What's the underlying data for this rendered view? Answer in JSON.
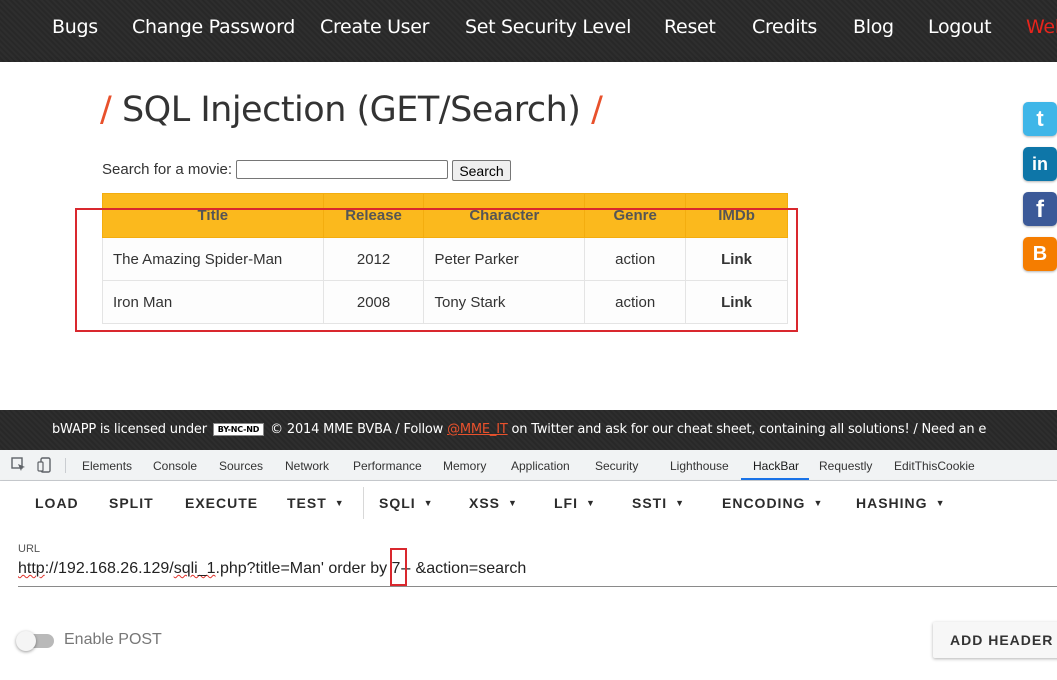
{
  "nav": {
    "items": [
      "Bugs",
      "Change Password",
      "Create User",
      "Set Security Level",
      "Reset",
      "Credits",
      "Blog",
      "Logout",
      "Wel"
    ]
  },
  "page": {
    "title": "SQL Injection (GET/Search)",
    "title_slash": "/"
  },
  "search": {
    "label": "Search for a movie:",
    "value": "",
    "button": "Search"
  },
  "table": {
    "headers": [
      "Title",
      "Release",
      "Character",
      "Genre",
      "IMDb"
    ],
    "rows": [
      [
        "The Amazing Spider-Man",
        "2012",
        "Peter Parker",
        "action",
        "Link"
      ],
      [
        "Iron Man",
        "2008",
        "Tony Stark",
        "action",
        "Link"
      ]
    ]
  },
  "social": [
    "t",
    "in",
    "f",
    "B"
  ],
  "footer": {
    "before": "bWAPP is licensed under",
    "badge": "BY-NC-ND",
    "middle": "© 2014 MME BVBA / Follow",
    "handle": "@MME_IT",
    "after": "on Twitter and ask for our cheat sheet, containing all solutions! / Need an e"
  },
  "devtools": {
    "tabs": [
      "Elements",
      "Console",
      "Sources",
      "Network",
      "Performance",
      "Memory",
      "Application",
      "Security",
      "Lighthouse",
      "HackBar",
      "Requestly",
      "EditThisCookie"
    ],
    "active_tab": "HackBar"
  },
  "hackbar": {
    "buttons": [
      "LOAD",
      "SPLIT",
      "EXECUTE",
      "TEST",
      "SQLI",
      "XSS",
      "LFI",
      "SSTI",
      "ENCODING",
      "HASHING"
    ],
    "url_label": "URL",
    "url": {
      "scheme": "http",
      "host_path_a": "://192.168.26.129/",
      "file": "sqli_1",
      "rest_a": ".php?title=Man' order by ",
      "number": "7",
      "rest_b": "-- &action=search"
    },
    "enable_post": "Enable POST",
    "add_header": "ADD HEADER"
  },
  "colors": {
    "accent_orange": "#e8512c",
    "table_header": "#fbb91d",
    "highlight_red": "#d9282e",
    "nav_bg": "#2b2b2b"
  }
}
